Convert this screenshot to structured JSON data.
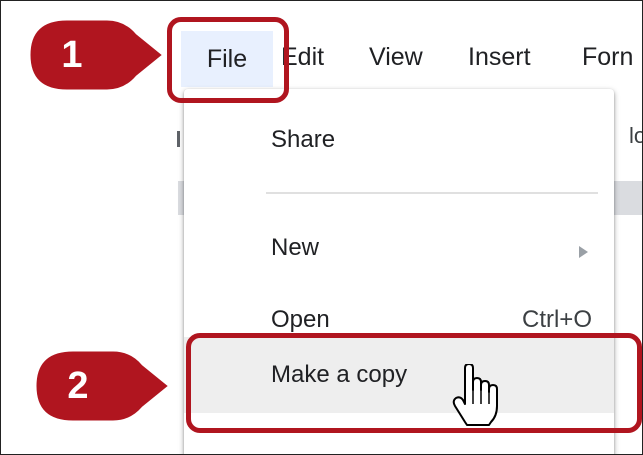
{
  "menubar": {
    "items": [
      {
        "label": "File"
      },
      {
        "label": "Edit"
      },
      {
        "label": "View"
      },
      {
        "label": "Insert"
      },
      {
        "label": "Forn"
      }
    ]
  },
  "background": {
    "fragment": "lo"
  },
  "dropdown": {
    "share": "Share",
    "new": "New",
    "open": "Open",
    "open_shortcut": "Ctrl+O",
    "make_copy": "Make a copy"
  },
  "callouts": {
    "step1": "1",
    "step2": "2"
  },
  "colors": {
    "callout_red": "#b0151f",
    "file_highlight": "#e8f0fe",
    "hover_gray": "#eeeeee"
  },
  "icons": {
    "cursor": "hand-pointer-icon",
    "submenu": "triangle-right-icon"
  }
}
